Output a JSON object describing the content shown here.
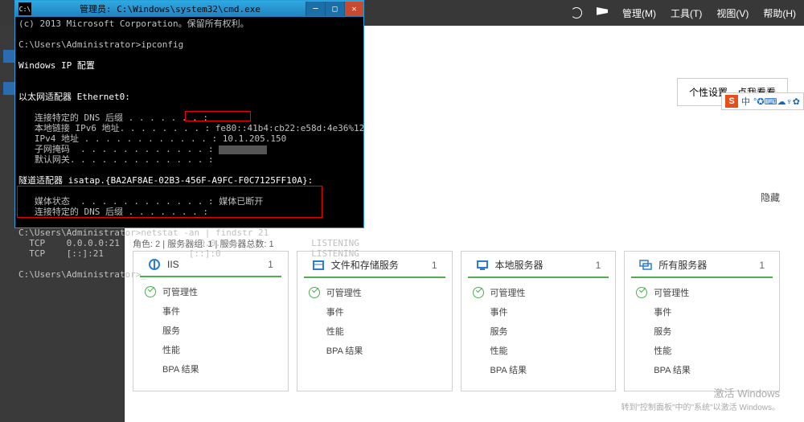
{
  "server_manager": {
    "topbar": {
      "manage": "管理(M)",
      "tools": "工具(T)",
      "view": "视图(V)",
      "help": "帮助(H)"
    },
    "settings_box": "个性设置，点我看看",
    "hide_label": "隐藏",
    "status_bar": "角色: 2 | 服务器组: 1 | 服务器总数: 1",
    "tiles": [
      {
        "title": "IIS",
        "count": "1",
        "items": [
          "可管理性",
          "事件",
          "服务",
          "性能",
          "BPA 结果"
        ]
      },
      {
        "title": "文件和存储服务",
        "count": "1",
        "items": [
          "可管理性",
          "事件",
          "性能",
          "BPA 结果"
        ]
      },
      {
        "title": "本地服务器",
        "count": "1",
        "items": [
          "可管理性",
          "事件",
          "服务",
          "性能",
          "BPA 结果"
        ]
      },
      {
        "title": "所有服务器",
        "count": "1",
        "items": [
          "可管理性",
          "事件",
          "服务",
          "性能",
          "BPA 结果"
        ]
      }
    ],
    "activate": {
      "title": "激活 Windows",
      "sub": "转到\"控制面板\"中的\"系统\"以激活 Windows。"
    }
  },
  "cmd": {
    "title": "管理员: C:\\Windows\\system32\\cmd.exe",
    "lines": {
      "copyright": "(c) 2013 Microsoft Corporation。保留所有权利。",
      "prompt1": "C:\\Users\\Administrator>ipconfig",
      "hdr": "Windows IP 配置",
      "adapter": "以太网适配器 Ethernet0:",
      "dns": "   连接特定的 DNS 后缀 . . . . . . . :",
      "ipv6": "   本地链接 IPv6 地址. . . . . . . . : fe80::41b4:cb22:e58d:4e36%12",
      "ipv4_lbl": "   IPv4 地址 . . . . . . . . . . . . : ",
      "ipv4_val": "10.1.205.150",
      "mask": "   子网掩码  . . . . . . . . . . . . : ",
      "gw": "   默认网关. . . . . . . . . . . . . :",
      "tunnel": "隧道适配器 isatap.{BA2AF8AE-02B3-456F-A9FC-F0C7125FF10A}:",
      "media": "   媒体状态  . . . . . . . . . . . . : 媒体已断开",
      "dns2": "   连接特定的 DNS 后缀 . . . . . . . :",
      "prompt2": "C:\\Users\\Administrator>netstat -an | findstr 21",
      "row1": "  TCP    0.0.0.0:21             0.0.0.0:0              LISTENING",
      "row2": "  TCP    [::]:21                [::]:0                 LISTENING",
      "prompt3": "C:\\Users\\Administrator>_"
    }
  },
  "ime": {
    "zh": "中",
    "items": [
      "°",
      "✪",
      "⌨",
      "☁",
      "♆",
      "✿"
    ]
  }
}
